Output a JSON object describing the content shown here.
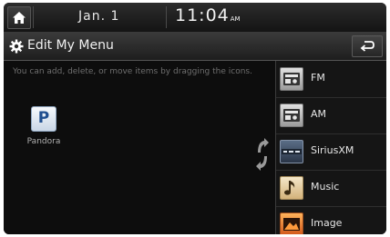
{
  "status_bar": {
    "date": "Jan.  1",
    "time": "11:04",
    "ampm": "AM"
  },
  "header": {
    "title": "Edit My Menu"
  },
  "left_panel": {
    "hint": "You can add, delete, or move items by dragging the icons.",
    "items": [
      {
        "label": "Pandora",
        "icon": "pandora-icon"
      }
    ]
  },
  "menu_list": [
    {
      "label": "FM",
      "icon": "radio-icon"
    },
    {
      "label": "AM",
      "icon": "radio-icon"
    },
    {
      "label": "SiriusXM",
      "icon": "siriusxm-icon"
    },
    {
      "label": "Music",
      "icon": "music-note-icon"
    },
    {
      "label": "Image",
      "icon": "image-icon"
    }
  ]
}
